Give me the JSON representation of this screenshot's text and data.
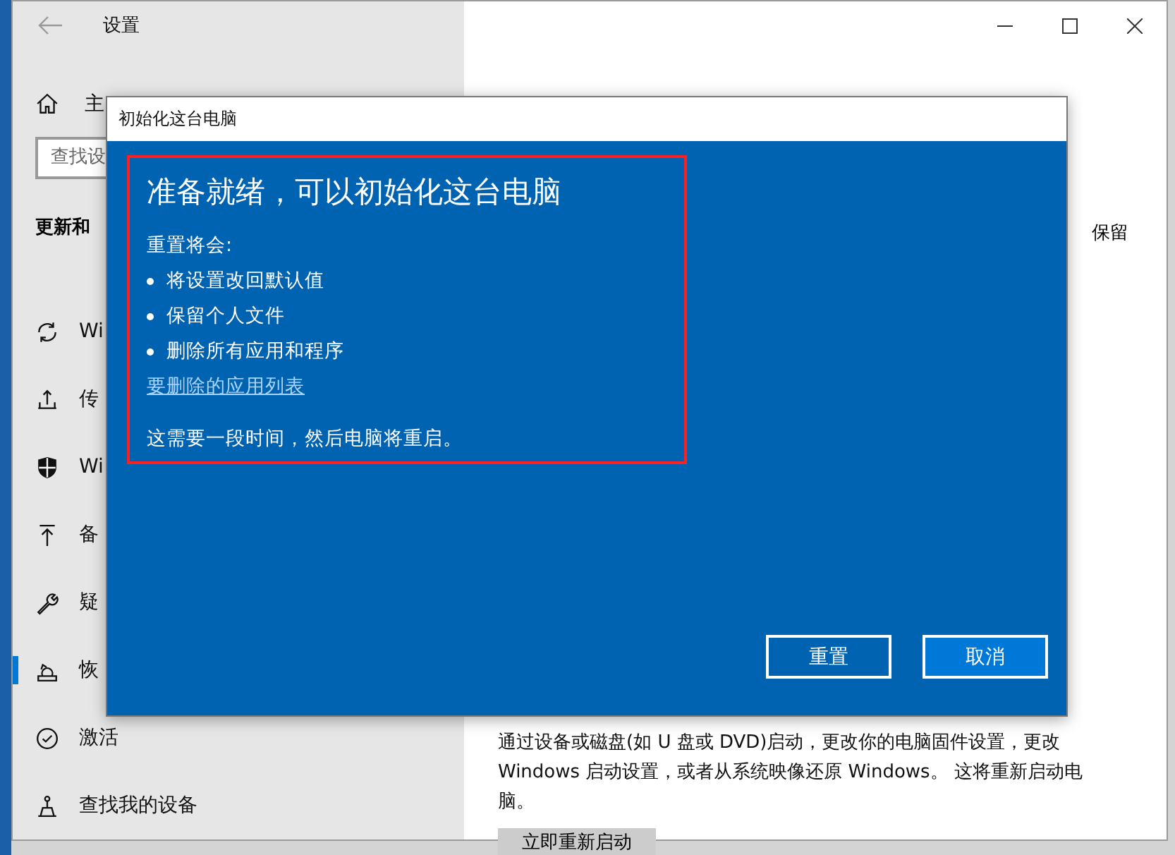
{
  "settings_window": {
    "title": "设置",
    "sidebar": {
      "home": "主",
      "search": {
        "placeholder": "查找设"
      },
      "section": "更新和",
      "items": [
        {
          "label": "Wi",
          "selected": false
        },
        {
          "label": "传",
          "selected": false
        },
        {
          "label": "Wi",
          "selected": false
        },
        {
          "label": "备",
          "selected": false
        },
        {
          "label": "疑",
          "selected": false
        },
        {
          "label": "恢",
          "selected": true
        },
        {
          "label": "激活",
          "selected": false
        },
        {
          "label": "查找我的设备",
          "selected": false
        }
      ]
    },
    "content": {
      "side_text": "保留",
      "description": "通过设备或磁盘(如 U 盘或 DVD)启动，更改你的电脑固件设置，更改 Windows 启动设置，或者从系统映像还原 Windows。 这将重新启动电脑。",
      "restart_button": "立即重新启动"
    }
  },
  "dialog": {
    "title": "初始化这台电脑",
    "heading": "准备就绪，可以初始化这台电脑",
    "intro": "重置将会:",
    "bullets": [
      "将设置改回默认值",
      "保留个人文件",
      "删除所有应用和程序"
    ],
    "link": "要删除的应用列表",
    "note": "这需要一段时间，然后电脑将重启。",
    "buttons": [
      {
        "label": "重置",
        "kind": "secondary"
      },
      {
        "label": "取消",
        "kind": "primary"
      }
    ]
  }
}
